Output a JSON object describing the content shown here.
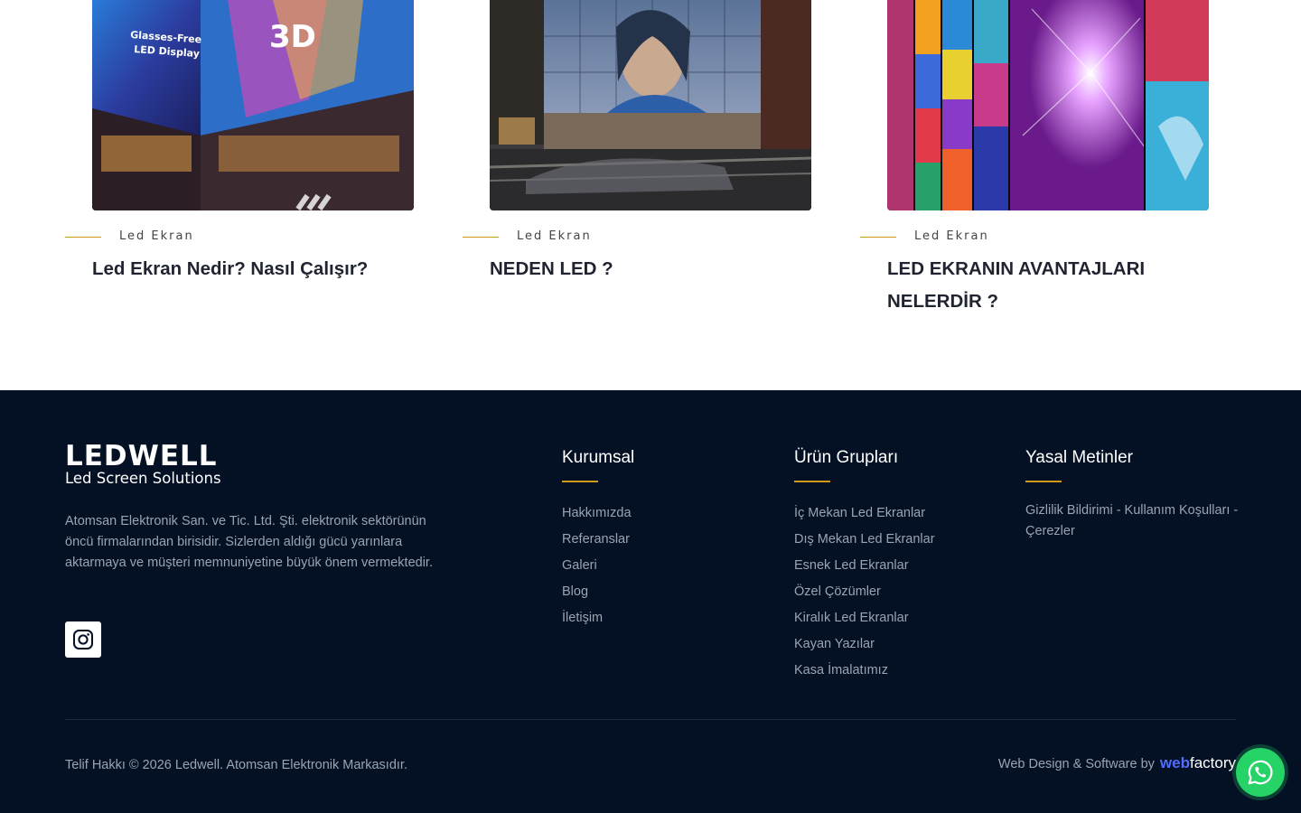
{
  "blog": {
    "cards": [
      {
        "category": "Led Ekran",
        "title": "Led Ekran Nedir? Nasıl Çalışır?",
        "image_text_1": "Glasses-Free",
        "image_text_2": "LED Display",
        "image_text_3": "3D"
      },
      {
        "category": "Led Ekran",
        "title": "NEDEN LED ?"
      },
      {
        "category": "Led Ekran",
        "title": "LED EKRANIN AVANTAJLARI NELERDİR ?"
      }
    ]
  },
  "footer": {
    "logo_main": "LEDWELL",
    "logo_sub": "Led Screen Solutions",
    "about": "Atomsan Elektronik San. ve Tic. Ltd. Şti. elektronik sektörünün öncü firmalarından birisidir. Sizlerden aldığı gücü yarınlara aktarmaya ve müşteri memnuniyetine büyük önem vermektedir.",
    "social_icon": "instagram-icon",
    "columns": {
      "kurumsal": {
        "title": "Kurumsal",
        "items": [
          "Hakkımızda",
          "Referanslar",
          "Galeri",
          "Blog",
          "İletişim"
        ]
      },
      "urun": {
        "title": "Ürün Grupları",
        "items": [
          "İç Mekan Led Ekranlar",
          "Dış Mekan Led Ekranlar",
          "Esnek Led Ekranlar",
          "Özel Çözümler",
          "Kiralık Led Ekranlar",
          "Kayan Yazılar",
          "Kasa İmalatımız"
        ]
      },
      "yasal": {
        "title": "Yasal Metinler",
        "text": "Gizlilik Bildirimi - Kullanım Koşulları - Çerezler"
      }
    },
    "copyright": "Telif Hakkı © 2026 Ledwell. Atomsan Elektronik Markasıdır.",
    "credit_prefix": "Web Design & Software by",
    "credit_brand_web": "web",
    "credit_brand_factory": "factory"
  },
  "colors": {
    "footer_bg": "#041124",
    "accent": "#d19a1d",
    "whatsapp": "#25d366",
    "brand_web": "#4f6dff"
  },
  "floating": {
    "icon": "whatsapp-icon"
  }
}
